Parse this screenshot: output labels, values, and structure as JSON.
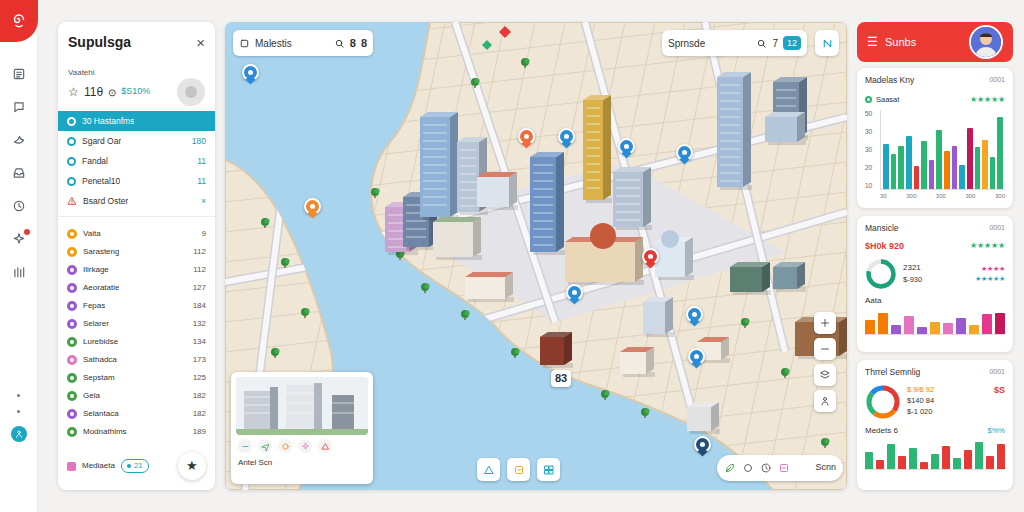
{
  "rail": {
    "items": [
      {
        "alert": false
      },
      {
        "alert": false
      },
      {
        "alert": false
      },
      {
        "alert": false
      },
      {
        "alert": false
      },
      {
        "alert": true
      },
      {
        "alert": false
      }
    ]
  },
  "left_panel": {
    "title": "Supulsga",
    "close": "×",
    "subtitle": "Vaatehi",
    "stats": {
      "star": "☆",
      "value": "11θ",
      "unit": "⊙",
      "percent": "$S10%"
    },
    "filters": [
      {
        "label": "30 Hastanfms",
        "selected": true,
        "kind": "normal",
        "color": "#ffffff"
      },
      {
        "label": "Sgard Oar",
        "value": "180",
        "selected": false,
        "kind": "normal",
        "color": "#1ba6c4"
      },
      {
        "label": "Fandal",
        "value": "11",
        "selected": false,
        "kind": "normal",
        "color": "#1ba6c4"
      },
      {
        "label": "Penetal10",
        "value": "11",
        "selected": false,
        "kind": "normal",
        "color": "#1ba6c4"
      },
      {
        "label": "Bsard Oster",
        "value": "×",
        "selected": false,
        "kind": "warning",
        "color": "#e53935"
      }
    ],
    "items": [
      {
        "label": "Vaita",
        "value": "9",
        "color": "#f59e0b"
      },
      {
        "label": "Sarasteng",
        "value": "112",
        "color": "#f59e0b"
      },
      {
        "label": "Ilirkage",
        "value": "112",
        "color": "#9b59d0"
      },
      {
        "label": "Aeoratatie",
        "value": "127",
        "color": "#9b59d0"
      },
      {
        "label": "Fepas",
        "value": "184",
        "color": "#9b59d0"
      },
      {
        "label": "Selarer",
        "value": "132",
        "color": "#9b59d0"
      },
      {
        "label": "Lurebidse",
        "value": "134",
        "color": "#43a047"
      },
      {
        "label": "Sathadca",
        "value": "173",
        "color": "#e573c0"
      },
      {
        "label": "Sepstam",
        "value": "125",
        "color": "#43a047"
      },
      {
        "label": "Gela",
        "value": "182",
        "color": "#43a047"
      },
      {
        "label": "Selantaca",
        "value": "182",
        "color": "#9b59d0"
      },
      {
        "label": "Modnathims",
        "value": "189",
        "color": "#43a047"
      }
    ],
    "footer": {
      "label": "Mediaeta",
      "badge": "21",
      "action": "★"
    }
  },
  "map": {
    "search_left": {
      "value": "Malestis",
      "chips": [
        "8",
        "8"
      ]
    },
    "search_right": {
      "value": "Sprnsde",
      "chips": [
        "7"
      ],
      "badge": "12"
    },
    "pins": [
      {
        "kind": "pin",
        "color": "#2a8bd6"
      },
      {
        "kind": "pin",
        "color": "#f08a2b"
      },
      {
        "kind": "pin",
        "color": "#f26b3a"
      },
      {
        "kind": "pin",
        "color": "#2a8bd6"
      },
      {
        "kind": "pin",
        "color": "#2a8bd6"
      },
      {
        "kind": "pin",
        "color": "#2a8bd6"
      },
      {
        "kind": "pin",
        "color": "#e53935"
      },
      {
        "kind": "pin",
        "color": "#2a8bd6"
      },
      {
        "kind": "pin",
        "color": "#2a8bd6"
      },
      {
        "kind": "pin",
        "color": "#2a8bd6"
      },
      {
        "kind": "label",
        "label": "83",
        "color": "#1f2f45"
      },
      {
        "kind": "pin",
        "color": "#1f4e79"
      }
    ],
    "inset": {
      "caption": "Antel Scn",
      "markers": [
        {
          "color": "#1ba6c4"
        },
        {
          "color": "#43a047"
        },
        {
          "color": "#f57c00"
        },
        {
          "color": "#e573c0"
        },
        {
          "color": "#e53935"
        }
      ]
    },
    "toolbar": {
      "label": "Scnn"
    }
  },
  "right_panel": {
    "header": {
      "menu": "☰",
      "title": "Sunbs"
    },
    "activity": {
      "title": "Madelas Kny",
      "code": "0001",
      "legend": {
        "label": "Saasat",
        "color": "#2bb673"
      },
      "rating": {
        "text": "★★★★★",
        "color": "#2bb673"
      },
      "chart": {
        "y_ticks": [
          "50",
          "30",
          "30",
          "20",
          "10"
        ],
        "x_ticks": [
          "30",
          "300",
          "300",
          "300",
          "300"
        ],
        "bars": [
          {
            "value": 28,
            "color": "#1ba6c4"
          },
          {
            "value": 22,
            "color": "#2bb673"
          },
          {
            "value": 27,
            "color": "#2bb673"
          },
          {
            "value": 33,
            "color": "#1ba6c4"
          },
          {
            "value": 14,
            "color": "#e53935"
          },
          {
            "value": 30,
            "color": "#2bb673"
          },
          {
            "value": 18,
            "color": "#9b59d0"
          },
          {
            "value": 37,
            "color": "#2bb673"
          },
          {
            "value": 24,
            "color": "#f57c00"
          },
          {
            "value": 27,
            "color": "#9b59d0"
          },
          {
            "value": 15,
            "color": "#1ba6c4"
          },
          {
            "value": 38,
            "color": "#c2185b"
          },
          {
            "value": 26,
            "color": "#2bb673"
          },
          {
            "value": 31,
            "color": "#f5a623"
          },
          {
            "value": 20,
            "color": "#2bb673"
          },
          {
            "value": 45,
            "color": "#2bb673"
          }
        ]
      }
    },
    "summary": {
      "title": "Mansicle",
      "code": "0001",
      "amount": "$H0k 920",
      "rating": {
        "text": "★★★★★",
        "color": "#2bb673"
      },
      "ring": {
        "level": 0.78,
        "color": "#1aa37a"
      },
      "count": "2321",
      "delta": "$-930",
      "ratings": [
        {
          "text": "★★★★",
          "color": "#e5398f"
        },
        {
          "text": "★★★★★",
          "color": "#1ba6c4"
        }
      ],
      "label": "Aata",
      "bars": [
        {
          "value": 8,
          "color": "#f57c00"
        },
        {
          "value": 12,
          "color": "#f57c00"
        },
        {
          "value": 5,
          "color": "#9b59d0"
        },
        {
          "value": 10,
          "color": "#e573c0"
        },
        {
          "value": 4,
          "color": "#9b59d0"
        },
        {
          "value": 7,
          "color": "#f5a623"
        },
        {
          "value": 6,
          "color": "#e573c0"
        },
        {
          "value": 9,
          "color": "#9b59d0"
        },
        {
          "value": 5,
          "color": "#f5a623"
        },
        {
          "value": 11,
          "color": "#e5398f"
        },
        {
          "value": 12,
          "color": "#c2185b"
        }
      ]
    },
    "trend": {
      "title": "Thrrel Semnlig",
      "code": "0001",
      "segments": [
        {
          "value": 35,
          "color": "#e53935"
        },
        {
          "value": 25,
          "color": "#f57c00"
        },
        {
          "value": 25,
          "color": "#2bb673"
        },
        {
          "value": 15,
          "color": "#1e88e5"
        }
      ],
      "amounts": [
        {
          "text": "$ 9/6 92",
          "color": "#f57c00"
        },
        {
          "text": "$140 84",
          "color": "#333333"
        },
        {
          "text": "$-1 020",
          "color": "#333333"
        }
      ],
      "flag": "$S",
      "label": "Medets 6",
      "percent": "$%%",
      "bars": [
        {
          "value": 8,
          "color": "#2bb673"
        },
        {
          "value": 4,
          "color": "#e53935"
        },
        {
          "value": 12,
          "color": "#2bb673"
        },
        {
          "value": 6,
          "color": "#e53935"
        },
        {
          "value": 10,
          "color": "#2bb673"
        },
        {
          "value": 3,
          "color": "#e53935"
        },
        {
          "value": 7,
          "color": "#2bb673"
        },
        {
          "value": 11,
          "color": "#e53935"
        },
        {
          "value": 5,
          "color": "#2bb673"
        },
        {
          "value": 9,
          "color": "#e53935"
        },
        {
          "value": 13,
          "color": "#2bb673"
        },
        {
          "value": 6,
          "color": "#e53935"
        },
        {
          "value": 12,
          "color": "#e53935"
        }
      ]
    }
  }
}
